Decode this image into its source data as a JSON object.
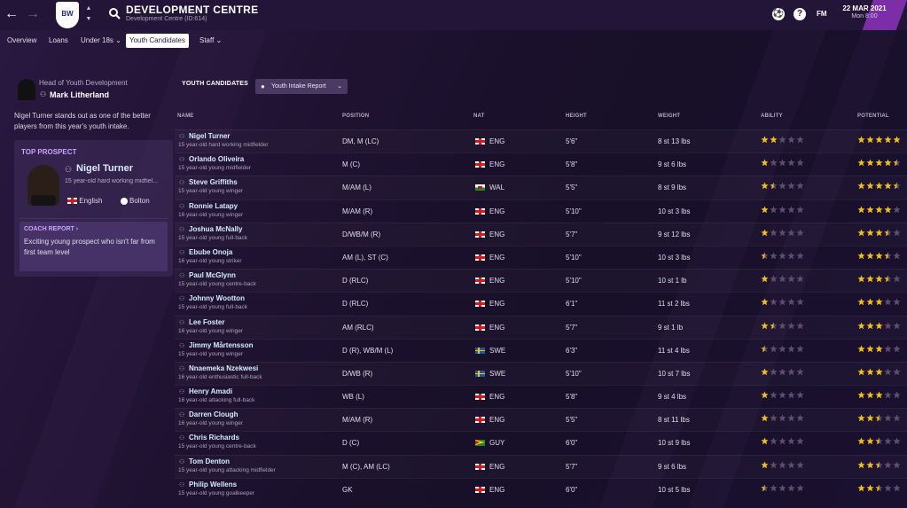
{
  "colors": {
    "accent": "#7b2ea8",
    "star_gold": "#f2c01e",
    "star_white": "#ffffff",
    "star_empty": "#5a4f6e"
  },
  "header": {
    "title": "DEVELOPMENT CENTRE",
    "subtitle": "Development Centre (ID:614)",
    "fm_label": "FM",
    "date": "22 MAR 2021",
    "time": "Mon 8:00"
  },
  "tabs": [
    {
      "label": "Overview"
    },
    {
      "label": "Loans"
    },
    {
      "label": "Under 18s ⌄"
    },
    {
      "label": "Youth Candidates"
    },
    {
      "label": "Staff ⌄"
    }
  ],
  "hoyd": {
    "label": "Head of Youth Development",
    "name": "Mark Litherland"
  },
  "intake_text": "Nigel Turner stands out as one of the better players from this year's youth intake.",
  "top_prospect": {
    "label": "TOP PROSPECT",
    "name": "Nigel Turner",
    "desc": "15 year-old hard working midfiel...",
    "nationality": "English",
    "club": "Bolton",
    "coach_report_label": "COACH REPORT ›",
    "coach_report_text": "Exciting young prospect who isn't far from first team level"
  },
  "table": {
    "section_label": "YOUTH CANDIDATES",
    "view_select": "Youth Intake Report",
    "columns": {
      "name": "NAME",
      "position": "POSITION",
      "nat": "NAT",
      "height": "HEIGHT",
      "weight": "WEIGHT",
      "ability": "ABILITY",
      "potential": "POTENTIAL"
    },
    "rows": [
      {
        "name": "Nigel Turner",
        "desc": "15 year-old hard working midfielder",
        "position": "DM, M (LC)",
        "nat": "ENG",
        "flag": "eng",
        "height": "5'6\"",
        "weight": "8 st 13 lbs",
        "ability": 2,
        "potential": 5
      },
      {
        "name": "Orlando Oliveira",
        "desc": "15 year-old young midfielder",
        "position": "M (C)",
        "nat": "ENG",
        "flag": "eng",
        "height": "5'8\"",
        "weight": "9 st 6 lbs",
        "ability": 1,
        "potential": 4.5
      },
      {
        "name": "Steve Griffiths",
        "desc": "15 year-old young winger",
        "position": "M/AM (L)",
        "nat": "WAL",
        "flag": "wal",
        "height": "5'5\"",
        "weight": "8 st 9 lbs",
        "ability": 1.5,
        "potential": 4.5
      },
      {
        "name": "Ronnie Latapy",
        "desc": "16 year-old young winger",
        "position": "M/AM (R)",
        "nat": "ENG",
        "flag": "eng",
        "height": "5'10\"",
        "weight": "10 st 3 lbs",
        "ability": 1,
        "potential": 4
      },
      {
        "name": "Joshua McNally",
        "desc": "15 year-old young full-back",
        "position": "D/WB/M (R)",
        "nat": "ENG",
        "flag": "eng",
        "height": "5'7\"",
        "weight": "9 st 12 lbs",
        "ability": 1,
        "potential": 3.5
      },
      {
        "name": "Ebube Onoja",
        "desc": "16 year-old young striker",
        "position": "AM (L), ST (C)",
        "nat": "ENG",
        "flag": "eng",
        "height": "5'10\"",
        "weight": "10 st 3 lbs",
        "ability": 0.5,
        "potential": 3.5
      },
      {
        "name": "Paul McGlynn",
        "desc": "15 year-old young centre-back",
        "position": "D (RLC)",
        "nat": "ENG",
        "flag": "eng",
        "height": "5'10\"",
        "weight": "10 st 1 lb",
        "ability": 1,
        "potential": 3.5
      },
      {
        "name": "Johnny Wootton",
        "desc": "15 year-old young full-back",
        "position": "D (RLC)",
        "nat": "ENG",
        "flag": "eng",
        "height": "6'1\"",
        "weight": "11 st 2 lbs",
        "ability": 1,
        "potential": 3
      },
      {
        "name": "Lee Foster",
        "desc": "16 year-old young winger",
        "position": "AM (RLC)",
        "nat": "ENG",
        "flag": "eng",
        "height": "5'7\"",
        "weight": "9 st 1 lb",
        "ability": 1.5,
        "potential": 3
      },
      {
        "name": "Jimmy Mårtensson",
        "desc": "15 year-old young winger",
        "position": "D (R), WB/M (L)",
        "nat": "SWE",
        "flag": "swe",
        "height": "6'3\"",
        "weight": "11 st 4 lbs",
        "ability": 0.5,
        "potential": 3
      },
      {
        "name": "Nnaemeka Nzekwesi",
        "desc": "16 year-old enthusiastic full-back",
        "position": "D/WB (R)",
        "nat": "SWE",
        "flag": "swe",
        "height": "5'10\"",
        "weight": "10 st 7 lbs",
        "ability": 1,
        "potential": 3
      },
      {
        "name": "Henry Amadi",
        "desc": "16 year-old attacking full-back",
        "position": "WB (L)",
        "nat": "ENG",
        "flag": "eng",
        "height": "5'8\"",
        "weight": "9 st 4 lbs",
        "ability": 1,
        "potential": 3
      },
      {
        "name": "Darren Clough",
        "desc": "16 year-old young winger",
        "position": "M/AM (R)",
        "nat": "ENG",
        "flag": "eng",
        "height": "5'5\"",
        "weight": "8 st 11 lbs",
        "ability": 1,
        "potential": 2.5
      },
      {
        "name": "Chris Richards",
        "desc": "15 year-old young centre-back",
        "position": "D (C)",
        "nat": "GUY",
        "flag": "guy",
        "height": "6'0\"",
        "weight": "10 st 9 lbs",
        "ability": 1,
        "potential": 2.5
      },
      {
        "name": "Tom Denton",
        "desc": "15 year-old young attacking midfielder",
        "position": "M (C), AM (LC)",
        "nat": "ENG",
        "flag": "eng",
        "height": "5'7\"",
        "weight": "9 st 6 lbs",
        "ability": 1,
        "potential": 2.5
      },
      {
        "name": "Philip Wellens",
        "desc": "15 year-old young goalkeeper",
        "position": "GK",
        "nat": "ENG",
        "flag": "eng",
        "height": "6'0\"",
        "weight": "10 st 5 lbs",
        "ability": 0.5,
        "potential": 2.5
      }
    ]
  }
}
